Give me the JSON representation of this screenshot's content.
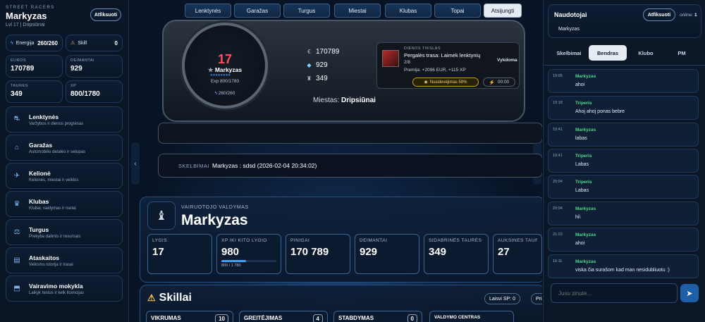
{
  "left": {
    "brand": "STREET RACERS",
    "username": "Markyzas",
    "subtitle": "Lvl 17 | Dripsiūnai",
    "fix_button": "Atfiksuoti",
    "energy_label": "Energija",
    "energy_value": "260/260",
    "skill_label": "Skill",
    "skill_value": "0",
    "stats": [
      {
        "label": "EUROS",
        "value": "170789"
      },
      {
        "label": "DEIMANTAI",
        "value": "929"
      },
      {
        "label": "TAURES",
        "value": "349"
      },
      {
        "label": "XP",
        "value": "800/1780"
      }
    ],
    "menu": [
      {
        "title": "Lenktynės",
        "sub": "Varžybos ir dienos progresas",
        "icon": "racing-icon"
      },
      {
        "title": "Garažas",
        "sub": "Automobilio detalės ir setupas",
        "icon": "garage-icon"
      },
      {
        "title": "Kelionė",
        "sub": "Kelionės, miestai ir veiklos",
        "icon": "travel-icon"
      },
      {
        "title": "Klubas",
        "sub": "Klubai, valdymas ir nariai",
        "icon": "club-icon"
      },
      {
        "title": "Turgus",
        "sub": "Prekyba dalimis ir resursais",
        "icon": "market-icon"
      },
      {
        "title": "Ataskaitos",
        "sub": "Veiksmu istorija ir irasai",
        "icon": "reports-icon"
      },
      {
        "title": "Vairavimo mokykla",
        "sub": "Laikyk testus ir kelk licencijas",
        "icon": "school-icon"
      }
    ]
  },
  "hud": {
    "level": "17",
    "name": "Markyzas",
    "exp": "Exp 800/1780",
    "hp": "260/260",
    "money": "170789",
    "diamonds": "929",
    "trophies": "349",
    "mission_tag": "DIENOS TIKSLAS",
    "mission_title": "Pergalės trasa: Laimėk lenktynių",
    "mission_progress": "2/8",
    "mission_reward": "Premija: +2096 EUR, +115 XP",
    "mission_status": "Vykdoma",
    "mood": "Nusidevėjimas 59%",
    "timer": "00:00",
    "city_label": "Miestas:",
    "city": "Dripsiūnai"
  },
  "nav": [
    "Lenktynės",
    "Garažas",
    "Turgus",
    "Miestai",
    "Klubas",
    "Topai",
    "Atsijungti"
  ],
  "ticker": {
    "label": "SKELBIMAI",
    "text": "Markyzas : sdsd (2026-02-04 20:34:02)"
  },
  "driver": {
    "tag": "VAIRUOTOJO VALDYMAS",
    "name": "Markyzas",
    "stats": [
      {
        "label": "LYGIS",
        "value": "17"
      },
      {
        "label": "XP IKI KITO LYGIO",
        "value": "980",
        "sub": "800 / 1 780",
        "progress": 0.45
      },
      {
        "label": "PINIGAI",
        "value": "170 789"
      },
      {
        "label": "DEIMANTAI",
        "value": "929"
      },
      {
        "label": "SIDABRINĖS TAURĖS",
        "value": "349"
      },
      {
        "label": "AUKSINĖS TAURĖS",
        "value": "27"
      }
    ]
  },
  "skills": {
    "title": "Skillai",
    "free_sp": "Laisvi SP: 0",
    "assign": "Priskirti",
    "items": [
      {
        "name": "VIKRUMAS",
        "value": "10"
      },
      {
        "name": "GREITĖJIMAS",
        "value": "4"
      },
      {
        "name": "STABDYMAS",
        "value": "0"
      },
      {
        "name": "VALDYMO CENTRAS",
        "value": ""
      }
    ]
  },
  "right": {
    "title": "Naudotojai",
    "fix_button": "Atfiksuoti",
    "online": "online:",
    "online_count": "1",
    "user": "Markyzas",
    "tabs": [
      "Skelbimai",
      "Bendras",
      "Klubo",
      "PM"
    ],
    "active_tab": 1,
    "messages": [
      {
        "time": "19:05",
        "name": "Markyzas",
        "text": "ahoi"
      },
      {
        "time": "19:18",
        "name": "Triperis",
        "text": "Ahoj ahoj ponas bebre"
      },
      {
        "time": "19:41",
        "name": "Markyzas",
        "text": "labas"
      },
      {
        "time": "19:41",
        "name": "Triperis",
        "text": "Labas"
      },
      {
        "time": "20:04",
        "name": "Triperis",
        "text": "Labas"
      },
      {
        "time": "20:04",
        "name": "Markyzas",
        "text": "hi\\"
      },
      {
        "time": "21:22",
        "name": "Markyzas",
        "text": "ahoi"
      },
      {
        "time": "16:11",
        "name": "Markyzas",
        "text": "viska čia surašom kad man nesidubliuotu :)"
      }
    ],
    "input_placeholder": "Jusu zinute...",
    "send_icon": "send-icon"
  }
}
